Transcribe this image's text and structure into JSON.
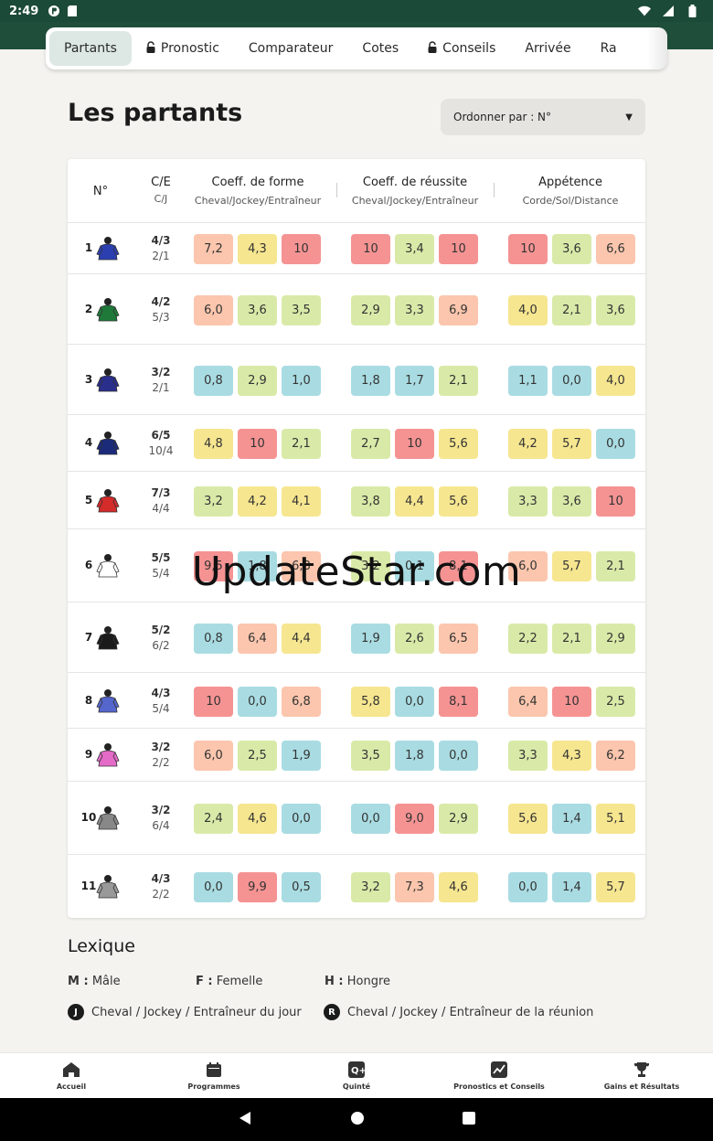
{
  "status": {
    "time": "2:49"
  },
  "tabs": [
    {
      "label": "Partants",
      "active": true,
      "locked": false
    },
    {
      "label": "Pronostic",
      "active": false,
      "locked": true
    },
    {
      "label": "Comparateur",
      "active": false,
      "locked": false
    },
    {
      "label": "Cotes",
      "active": false,
      "locked": false
    },
    {
      "label": "Conseils",
      "active": false,
      "locked": true
    },
    {
      "label": "Arrivée",
      "active": false,
      "locked": false
    },
    {
      "label": "Ra",
      "active": false,
      "locked": false
    }
  ],
  "page_title": "Les partants",
  "sort": {
    "label": "Ordonner par : N°"
  },
  "table": {
    "headers": {
      "no": "N°",
      "ce": "C/E",
      "cj": "C/J",
      "forme": "Coeff. de forme",
      "forme_sub": "Cheval/Jockey/Entraîneur",
      "reussite": "Coeff. de réussite",
      "reussite_sub": "Cheval/Jockey/Entraîneur",
      "appetence": "Appétence",
      "appetence_sub": "Corde/Sol/Distance"
    },
    "rows": [
      {
        "num": "1",
        "ce": "4/3",
        "cj": "2/1",
        "silk": "#2b3fb0",
        "values": [
          "7,2",
          "4,3",
          "10",
          "10",
          "3,4",
          "10",
          "10",
          "3,6",
          "6,6"
        ],
        "colors": [
          "pch",
          "yel",
          "red",
          "red",
          "grn",
          "red",
          "red",
          "grn",
          "pch"
        ]
      },
      {
        "num": "2",
        "ce": "4/2",
        "cj": "5/3",
        "silk": "#1f7a3a",
        "values": [
          "6,0",
          "3,6",
          "3,5",
          "2,9",
          "3,3",
          "6,9",
          "4,0",
          "2,1",
          "3,6"
        ],
        "colors": [
          "pch",
          "grn",
          "grn",
          "grn",
          "grn",
          "pch",
          "yel",
          "grn",
          "grn"
        ]
      },
      {
        "num": "3",
        "ce": "3/2",
        "cj": "2/1",
        "silk": "#2a2f8c",
        "values": [
          "0,8",
          "2,9",
          "1,0",
          "1,8",
          "1,7",
          "2,1",
          "1,1",
          "0,0",
          "4,0"
        ],
        "colors": [
          "blu",
          "grn",
          "blu",
          "blu",
          "blu",
          "grn",
          "blu",
          "blu",
          "yel"
        ]
      },
      {
        "num": "4",
        "ce": "6/5",
        "cj": "10/4",
        "silk": "#1c2a7a",
        "values": [
          "4,8",
          "10",
          "2,1",
          "2,7",
          "10",
          "5,6",
          "4,2",
          "5,7",
          "0,0"
        ],
        "colors": [
          "yel",
          "red",
          "grn",
          "grn",
          "red",
          "yel",
          "yel",
          "yel",
          "blu"
        ]
      },
      {
        "num": "5",
        "ce": "7/3",
        "cj": "4/4",
        "silk": "#d42b2b",
        "values": [
          "3,2",
          "4,2",
          "4,1",
          "3,8",
          "4,4",
          "5,6",
          "3,3",
          "3,6",
          "10"
        ],
        "colors": [
          "grn",
          "yel",
          "yel",
          "grn",
          "yel",
          "yel",
          "grn",
          "grn",
          "red"
        ]
      },
      {
        "num": "6",
        "ce": "5/5",
        "cj": "5/4",
        "silk": "#ffffff",
        "values": [
          "9,5",
          "1,8",
          "6,8",
          "3,2",
          "0,1",
          "8,1",
          "6,0",
          "5,7",
          "2,1"
        ],
        "colors": [
          "red",
          "blu",
          "pch",
          "grn",
          "blu",
          "red",
          "pch",
          "yel",
          "grn"
        ]
      },
      {
        "num": "7",
        "ce": "5/2",
        "cj": "6/2",
        "silk": "#1b1b1b",
        "values": [
          "0,8",
          "6,4",
          "4,4",
          "1,9",
          "2,6",
          "6,5",
          "2,2",
          "2,1",
          "2,9"
        ],
        "colors": [
          "blu",
          "pch",
          "yel",
          "blu",
          "grn",
          "pch",
          "grn",
          "grn",
          "grn"
        ]
      },
      {
        "num": "8",
        "ce": "4/3",
        "cj": "5/4",
        "silk": "#5566cc",
        "values": [
          "10",
          "0,0",
          "6,8",
          "5,8",
          "0,0",
          "8,1",
          "6,4",
          "10",
          "2,5"
        ],
        "colors": [
          "red",
          "blu",
          "pch",
          "yel",
          "blu",
          "red",
          "pch",
          "red",
          "grn"
        ]
      },
      {
        "num": "9",
        "ce": "3/2",
        "cj": "2/2",
        "silk": "#e46bc8",
        "values": [
          "6,0",
          "2,5",
          "1,9",
          "3,5",
          "1,8",
          "0,0",
          "3,3",
          "4,3",
          "6,2"
        ],
        "colors": [
          "pch",
          "grn",
          "blu",
          "grn",
          "blu",
          "blu",
          "grn",
          "yel",
          "pch"
        ]
      },
      {
        "num": "10",
        "ce": "3/2",
        "cj": "6/4",
        "silk": "#888888",
        "values": [
          "2,4",
          "4,6",
          "0,0",
          "0,0",
          "9,0",
          "2,9",
          "5,6",
          "1,4",
          "5,1"
        ],
        "colors": [
          "grn",
          "yel",
          "blu",
          "blu",
          "red",
          "grn",
          "yel",
          "blu",
          "yel"
        ]
      },
      {
        "num": "11",
        "ce": "4/3",
        "cj": "2/2",
        "silk": "#999999",
        "values": [
          "0,0",
          "9,9",
          "0,5",
          "3,2",
          "7,3",
          "4,6",
          "0,0",
          "1,4",
          "5,7"
        ],
        "colors": [
          "blu",
          "red",
          "blu",
          "grn",
          "pch",
          "yel",
          "blu",
          "blu",
          "yel"
        ]
      }
    ]
  },
  "watermark": "UpdateStar.com",
  "lexique": {
    "title": "Lexique",
    "m_key": "M :",
    "m_val": "Mâle",
    "f_key": "F :",
    "f_val": "Femelle",
    "h_key": "H :",
    "h_val": "Hongre",
    "j_badge": "J",
    "j_text": "Cheval / Jockey / Entraîneur du jour",
    "r_badge": "R",
    "r_text": "Cheval / Jockey / Entraîneur de la réunion"
  },
  "bottomnav": [
    {
      "label": "Accueil",
      "icon": "home-icon"
    },
    {
      "label": "Programmes",
      "icon": "calendar-icon"
    },
    {
      "label": "Quinté",
      "icon": "quinte-icon"
    },
    {
      "label": "Pronostics et Conseils",
      "icon": "chart-icon"
    },
    {
      "label": "Gains et Résultats",
      "icon": "trophy-icon"
    }
  ]
}
